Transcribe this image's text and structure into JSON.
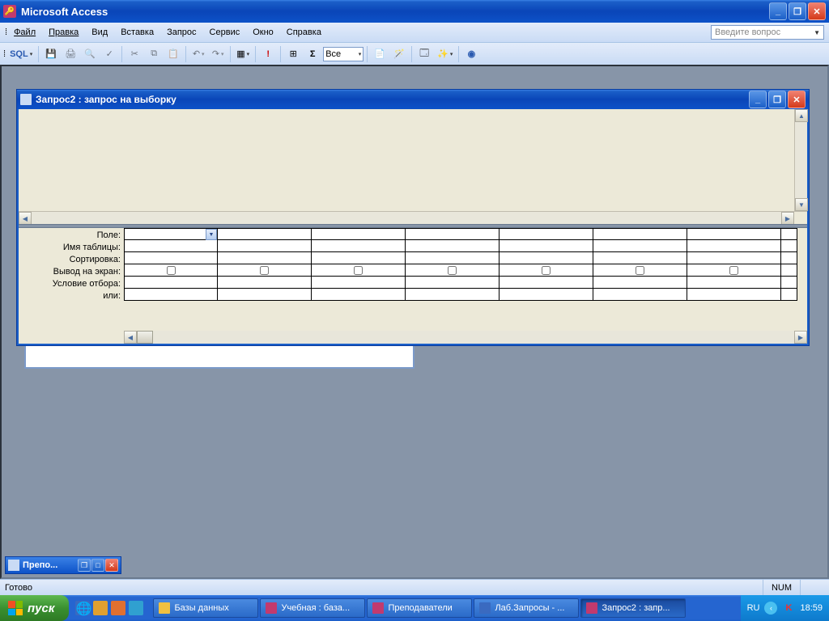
{
  "app": {
    "title": "Microsoft Access"
  },
  "menu": {
    "file": "Файл",
    "edit": "Правка",
    "view": "Вид",
    "insert": "Вставка",
    "query": "Запрос",
    "tools": "Сервис",
    "window": "Окно",
    "help": "Справка"
  },
  "question_placeholder": "Введите вопрос",
  "toolbar": {
    "sql": "SQL",
    "combo_all": "Все",
    "sigma": "Σ"
  },
  "child_window": {
    "title": "Запрос2 : запрос на выборку"
  },
  "grid_labels": {
    "field": "Поле:",
    "table": "Имя таблицы:",
    "sort": "Сортировка:",
    "show": "Вывод на экран:",
    "criteria": "Условие отбора:",
    "or": "или:"
  },
  "minimized": {
    "title": "Препо..."
  },
  "status": {
    "ready": "Готово",
    "num": "NUM"
  },
  "taskbar": {
    "start": "пуск",
    "items": [
      {
        "label": "Базы данных",
        "color": "#f0c040"
      },
      {
        "label": "Учебная : база...",
        "color": "#c23a6e"
      },
      {
        "label": "Преподаватели",
        "color": "#c23a6e"
      },
      {
        "label": "Лаб.Запросы - ...",
        "color": "#3a6ac0"
      },
      {
        "label": "Запрос2 : запр...",
        "color": "#c23a6e",
        "active": true
      }
    ],
    "lang": "RU",
    "time": "18:59"
  }
}
